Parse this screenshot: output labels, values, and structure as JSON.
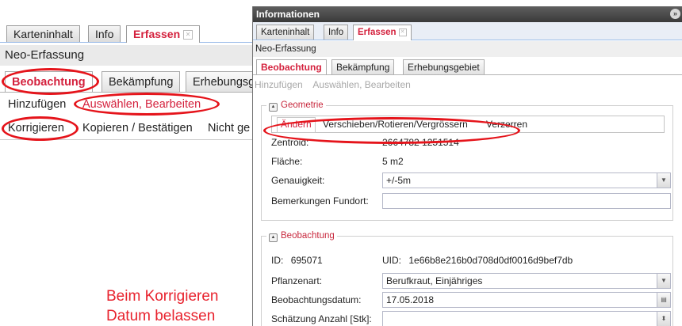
{
  "left_panel": {
    "tabs": [
      "Karteninhalt",
      "Info",
      "Erfassen"
    ],
    "title": "Neo-Erfassung",
    "subtabs": [
      "Beobachtung",
      "Bekämpfung",
      "Erhebungsg"
    ],
    "actions": [
      "Hinzufügen",
      "Auswählen, Bearbeiten"
    ],
    "subactions": [
      "Korrigieren",
      "Kopieren / Bestätigen",
      "Nicht ge"
    ]
  },
  "annotation": {
    "lines": [
      "Beim Korrigieren",
      "Datum belassen"
    ],
    "color": "#e8222d"
  },
  "window": {
    "title": "Informationen",
    "collapse_icon": "double-chevron-right",
    "tabs": [
      "Karteninhalt",
      "Info",
      "Erfassen"
    ],
    "section_title": "Neo-Erfassung",
    "subtabs": [
      "Beobachtung",
      "Bekämpfung",
      "Erhebungsgebiet"
    ],
    "actions": [
      "Hinzufügen",
      "Auswählen, Bearbeiten"
    ],
    "geometry": {
      "legend": "Geometrie",
      "modes": [
        "Ändern",
        "Verschieben/Rotieren/Vergrössern",
        "Verzerren"
      ],
      "zentroid_label": "Zentroid:",
      "zentroid_value": "2664782 1251514",
      "flaeche_label": "Fläche:",
      "flaeche_value": "5 m2",
      "genauigkeit_label": "Genauigkeit:",
      "genauigkeit_value": "+/-5m",
      "bemerkungen_label": "Bemerkungen Fundort:",
      "bemerkungen_value": ""
    },
    "observation": {
      "legend": "Beobachtung",
      "id_label": "ID:",
      "id_value": "695071",
      "uid_label": "UID:",
      "uid_value": "1e66b8e216b0d708d0df0016d9bef7db",
      "pflanzenart_label": "Pflanzenart:",
      "pflanzenart_value": "Berufkraut, Einjähriges",
      "datum_label": "Beobachtungsdatum:",
      "datum_value": "17.05.2018",
      "anzahl_label": "Schätzung Anzahl [Stk]:",
      "anzahl_value": ""
    }
  },
  "colors": {
    "accent": "#d4213d",
    "highlight_ring": "#e5141b",
    "titlebar": "#4a4a4a"
  }
}
